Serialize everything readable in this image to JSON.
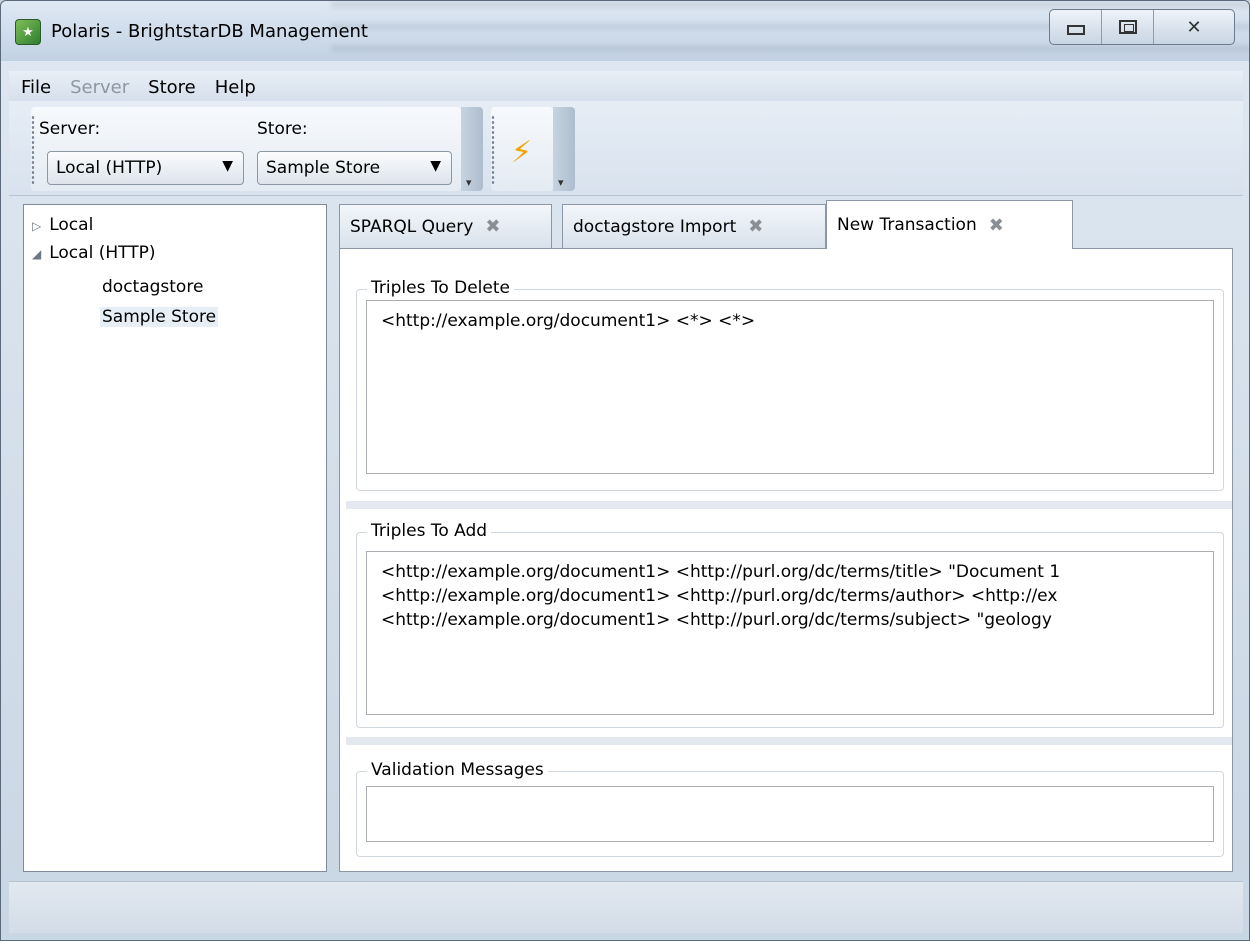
{
  "window": {
    "title": "Polaris - BrightstarDB Management",
    "icon": "polaris-app-icon",
    "caption_buttons": [
      "minimize-icon",
      "maximize-icon",
      "close-icon"
    ],
    "close_glyph": "✕"
  },
  "menu": {
    "items": [
      {
        "label": "File",
        "enabled": true
      },
      {
        "label": "Server",
        "enabled": false
      },
      {
        "label": "Store",
        "enabled": true
      },
      {
        "label": "Help",
        "enabled": true
      }
    ]
  },
  "toolbar": {
    "server_label": "Server:",
    "store_label": "Store:",
    "server_value": "Local (HTTP)",
    "store_value": "Sample Store",
    "combo_arrow": "▼",
    "run_icon": "lightning-icon",
    "run_glyph": "⚡"
  },
  "tree": {
    "collapsed_glyph": "▷",
    "expanded_glyph": "◢",
    "items": [
      {
        "label": "Local",
        "expanded": false
      },
      {
        "label": "Local (HTTP)",
        "expanded": true
      },
      {
        "label": "doctagstore"
      },
      {
        "label": "Sample Store",
        "selected": true
      }
    ]
  },
  "tabs": {
    "close_glyph": "✖",
    "items": [
      {
        "label": "SPARQL Query",
        "active": false
      },
      {
        "label": "doctagstore Import",
        "active": false
      },
      {
        "label": "New Transaction",
        "active": true
      }
    ]
  },
  "transaction": {
    "delete_title": "Triples To Delete",
    "delete_text": "<http://example.org/document1> <*> <*>",
    "add_title": "Triples To Add",
    "add_lines": [
      "<http://example.org/document1> <http://purl.org/dc/terms/title> \"Document 1",
      "<http://example.org/document1> <http://purl.org/dc/terms/author> <http://ex",
      "<http://example.org/document1> <http://purl.org/dc/terms/subject> \"geology"
    ],
    "validation_title": "Validation Messages",
    "validation_text": ""
  }
}
